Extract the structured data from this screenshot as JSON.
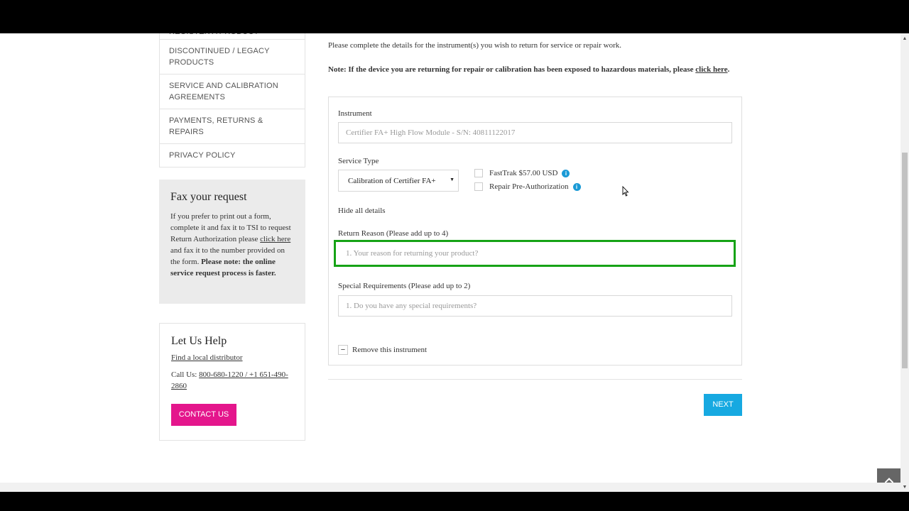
{
  "sidebar": {
    "items": [
      {
        "label": "REGISTER A PRODUCT"
      },
      {
        "label": "DISCONTINUED / LEGACY PRODUCTS"
      },
      {
        "label": "SERVICE AND CALIBRATION AGREEMENTS"
      },
      {
        "label": "PAYMENTS, RETURNS & REPAIRS"
      },
      {
        "label": "PRIVACY POLICY"
      }
    ]
  },
  "fax": {
    "title": "Fax your request",
    "text_before": "If you prefer to print out a form, complete it and fax it to TSI to request Return Authorization please ",
    "link": "click here",
    "text_after": " and fax it to the number provided on the form.",
    "bold_note": "Please note: the online service request process is faster."
  },
  "help": {
    "title": "Let Us Help",
    "distributor_link": "Find a local distributor",
    "call_label": "Call Us: ",
    "phone": "800-680-1220 / +1 651-490-2860",
    "contact_button": "CONTACT US"
  },
  "main": {
    "intro": "Please complete the details for the instrument(s) you wish to return for service or repair work.",
    "note_text": "Note: If the device you are returning for repair or calibration has been exposed to hazardous materials, please ",
    "note_link": "click here",
    "note_end": "."
  },
  "form": {
    "instrument_label": "Instrument",
    "instrument_value": "Certifier FA+ High Flow Module - S/N: 40811122017",
    "service_type_label": "Service Type",
    "service_type_value": "Calibration of Certifier FA+",
    "fasttrak_label": "FastTrak $57.00 USD",
    "repair_label": "Repair Pre-Authorization",
    "hide_details": "Hide all details",
    "return_reason_label": "Return Reason (Please add up to 4)",
    "return_reason_placeholder": "1. Your reason for returning your product?",
    "special_label": "Special Requirements (Please add up to 2)",
    "special_placeholder": "1. Do you have any special requirements?",
    "remove_label": "Remove this instrument"
  },
  "next_button": "NEXT",
  "icons": {
    "info": "info-icon",
    "minus": "minus-icon",
    "back_to_top": "chevron-up-icon",
    "cursor": "mouse-cursor-icon"
  },
  "colors": {
    "contact_button": "#e4168c",
    "next_button": "#17a9e1",
    "highlight": "#16a316",
    "info": "#1a9ad6"
  }
}
